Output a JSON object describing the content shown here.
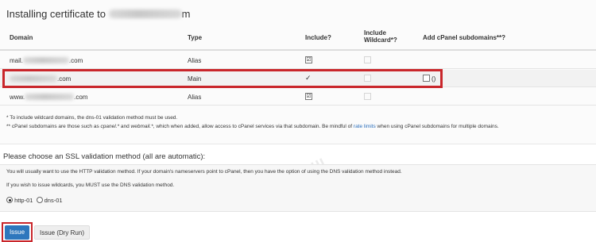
{
  "header": {
    "title": "Installing certificate to",
    "title_suffix": "m"
  },
  "table": {
    "columns": [
      "Domain",
      "Type",
      "Include?",
      "Include Wildcard*?",
      "Add cPanel subdomains**?"
    ],
    "rows": [
      {
        "domain_prefix": "mail.",
        "domain_suffix": ".com",
        "type": "Alias",
        "include": "☑"
      },
      {
        "domain_prefix": "",
        "domain_suffix": ".com",
        "type": "Main",
        "include": "✓",
        "subdomains_label": "()"
      },
      {
        "domain_prefix": "www.",
        "domain_suffix": ".com",
        "type": "Alias",
        "include": "☑"
      }
    ]
  },
  "notes": {
    "line1": "* To include wildcard domains, the dns-01 validation method must be used.",
    "line2_a": "** cPanel subdomains are those such as",
    "line2_b": "cpanel.*",
    "line2_c": "and",
    "line2_d": "webmail.*",
    "line2_e": ", which when added, allow access to cPanel services via that subdomain. Be mindful of",
    "line2_link": "rate limits",
    "line2_f": "when using cPanel subdomains for multiple domains."
  },
  "validation": {
    "heading": "Please choose an SSL validation method (all are automatic):",
    "text1": "You will usually want to use the HTTP validation method. If your domain's nameservers point to cPanel, then you have the option of using the DNS validation method instead.",
    "text2": "If you wish to issue wildcards, you MUST use the DNS validation method.",
    "options": [
      "http-01",
      "dns-01"
    ],
    "selected": "http-01"
  },
  "buttons": {
    "issue": "Issue",
    "dry_run": "Issue (Dry Run)"
  },
  "colors": {
    "primary": "#2e77bd",
    "highlight": "#c9262b",
    "link": "#2a6ebb"
  }
}
